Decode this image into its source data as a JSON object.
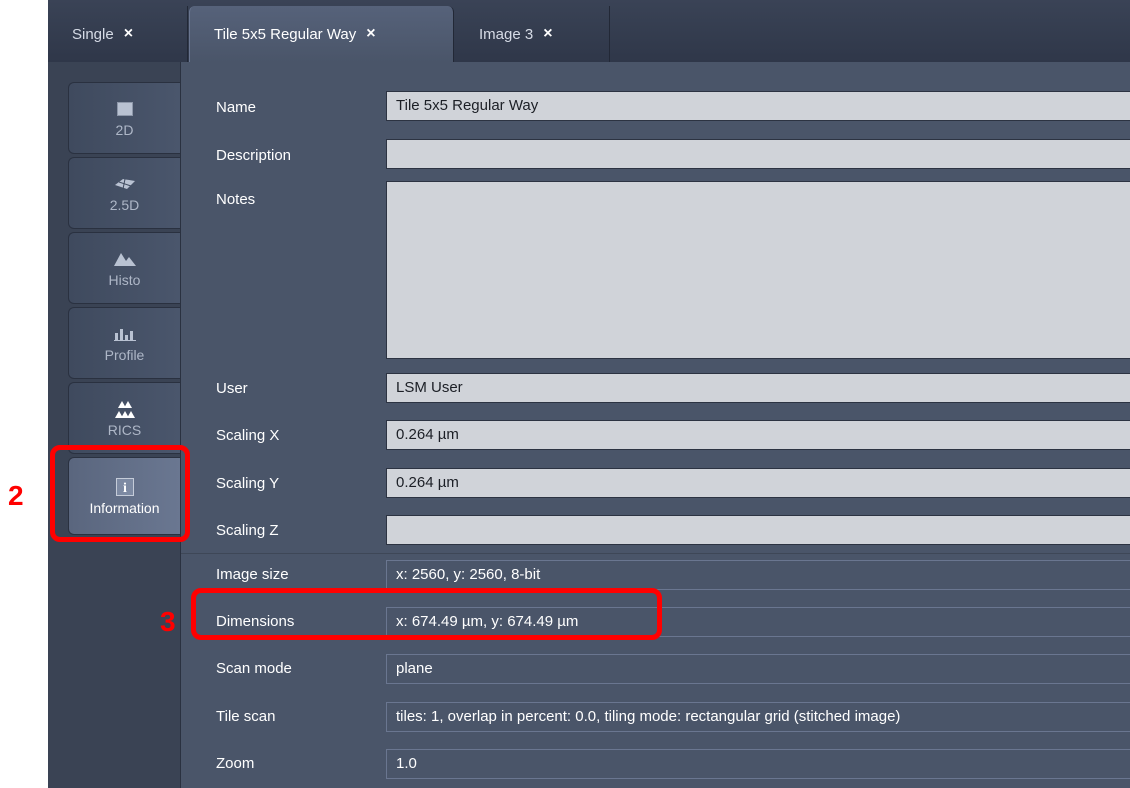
{
  "tabs": [
    {
      "label": "Single",
      "close": "×",
      "active": false
    },
    {
      "label": "Tile 5x5 Regular Way",
      "close": "×",
      "active": true
    },
    {
      "label": "Image 3",
      "close": "×",
      "active": false
    }
  ],
  "sidebar": {
    "items": [
      {
        "label": "2D",
        "icon": "2d-view-icon"
      },
      {
        "label": "2.5D",
        "icon": "2-5d-view-icon"
      },
      {
        "label": "Histo",
        "icon": "histogram-icon"
      },
      {
        "label": "Profile",
        "icon": "profile-icon"
      },
      {
        "label": "RICS",
        "icon": "rics-icon"
      },
      {
        "label": "Information",
        "icon": "info-icon",
        "active": true
      }
    ]
  },
  "info": {
    "name": {
      "label": "Name",
      "value": "Tile 5x5 Regular Way"
    },
    "description": {
      "label": "Description",
      "value": ""
    },
    "notes": {
      "label": "Notes",
      "value": ""
    },
    "user": {
      "label": "User",
      "value": "LSM User"
    },
    "scaling_x": {
      "label": "Scaling X",
      "value": "0.264 µm"
    },
    "scaling_y": {
      "label": "Scaling Y",
      "value": "0.264 µm"
    },
    "scaling_z": {
      "label": "Scaling Z",
      "value": ""
    },
    "image_size": {
      "label": "Image size",
      "value": "x: 2560, y: 2560, 8-bit"
    },
    "dimensions": {
      "label": "Dimensions",
      "value": "x: 674.49 µm, y: 674.49 µm"
    },
    "scan_mode": {
      "label": "Scan mode",
      "value": "plane"
    },
    "tile_scan": {
      "label": "Tile scan",
      "value": "tiles: 1, overlap in percent: 0.0, tiling mode: rectangular grid (stitched image)"
    },
    "zoom": {
      "label": "Zoom",
      "value": "1.0"
    }
  },
  "annotations": {
    "marker_2": "2",
    "marker_3": "3",
    "color": "#ff0000"
  },
  "colors": {
    "panel_bg": "#4a5569",
    "sidebar_bg": "#3a4354",
    "field_bg": "#d0d3d9"
  }
}
